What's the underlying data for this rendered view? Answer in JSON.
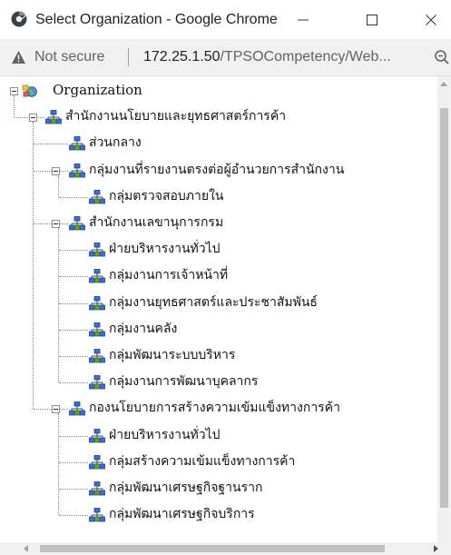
{
  "window": {
    "title": "Select Organization - Google Chrome",
    "controls": [
      "minimize-icon",
      "maximize-icon",
      "close-icon"
    ]
  },
  "addressbar": {
    "security_label": "Not secure",
    "url_host": "172.25.1.50",
    "url_path": "/TPSOCompetency/Web...",
    "icons": [
      "warning-icon",
      "zoom-icon"
    ]
  },
  "tree": {
    "root": {
      "label": "Organization",
      "icon": "organization-globe-icon",
      "expanded": true
    },
    "nodes": [
      {
        "label": "สำนักงานนโยบายและยุทธศาสตร์การค้า",
        "level": 1,
        "expanded": true
      },
      {
        "label": "ส่วนกลาง",
        "level": 2
      },
      {
        "label": "กลุ่มงานที่รายงานตรงต่อผู้อำนวยการสำนักงาน",
        "level": 2,
        "expanded": true
      },
      {
        "label": "กลุ่มตรวจสอบภายใน",
        "level": 3
      },
      {
        "label": "สำนักงานเลขานุการกรม",
        "level": 2,
        "expanded": true
      },
      {
        "label": "ฝ่ายบริหารงานทั่วไป",
        "level": 3
      },
      {
        "label": "กลุ่มงานการเจ้าหน้าที่",
        "level": 3
      },
      {
        "label": "กลุ่มงานยุทธศาสตร์และประชาสัมพันธ์",
        "level": 3
      },
      {
        "label": "กลุ่มงานคลัง",
        "level": 3
      },
      {
        "label": "กลุ่มพัฒนาระบบบริหาร",
        "level": 3
      },
      {
        "label": "กลุ่มงานการพัฒนาบุคลากร",
        "level": 3
      },
      {
        "label": "กองนโยบายการสร้างความเข้มแข็งทางการค้า",
        "level": 2,
        "expanded": true
      },
      {
        "label": "ฝ่ายบริหารงานทั่วไป",
        "level": 3
      },
      {
        "label": "กลุ่มสร้างความเข้มแข็งทางการค้า",
        "level": 3
      },
      {
        "label": "กลุ่มพัฒนาเศรษฐกิจฐานราก",
        "level": 3
      },
      {
        "label": "กลุ่มพัฒนาเศรษฐกิจบริการ",
        "level": 3
      }
    ]
  },
  "colors": {
    "node_icon_blue": "#3b6fd3",
    "node_icon_dark": "#1e3f8f",
    "warning": "#5f6368"
  }
}
